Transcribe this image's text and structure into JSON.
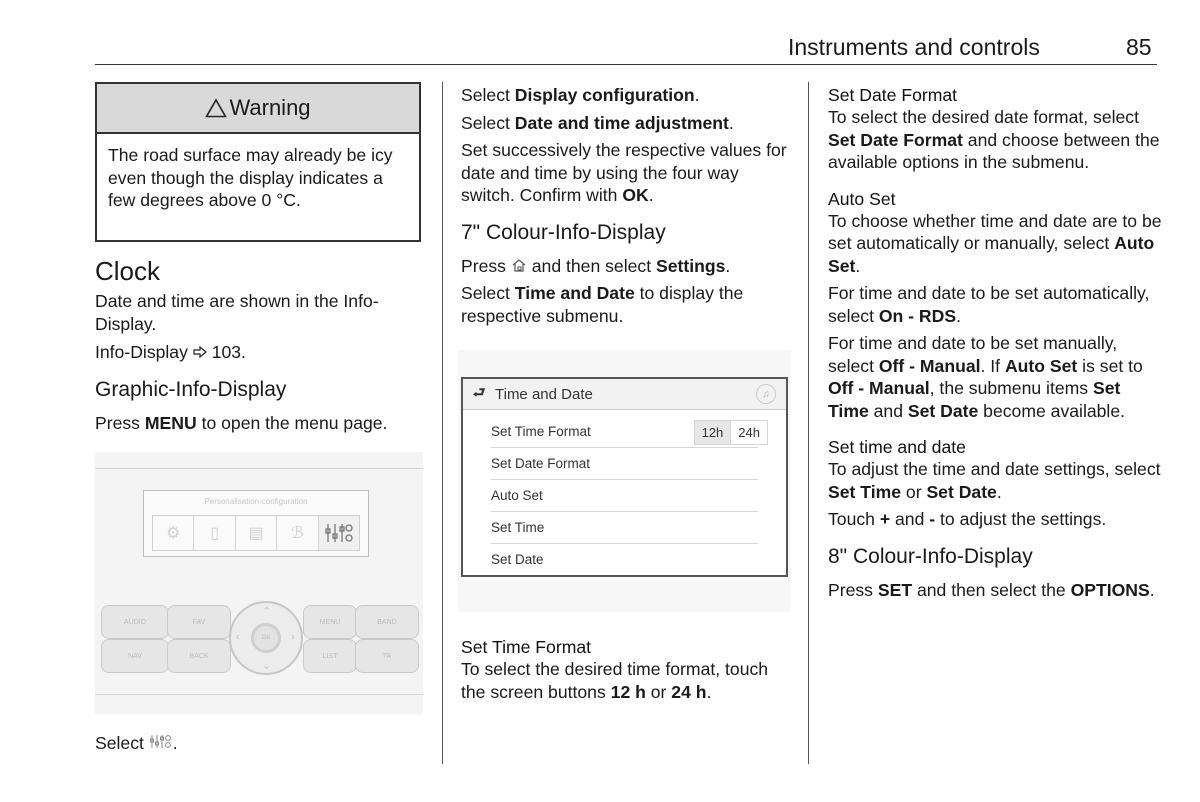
{
  "header": {
    "section_title": "Instruments and controls",
    "page_number": "85"
  },
  "warning": {
    "icon": "warning-triangle-icon",
    "title": "Warning",
    "text": "The road surface may already be icy even though the display indicates a few degrees above 0 °C."
  },
  "col1": {
    "clock_heading": "Clock",
    "clock_text": "Date and time are shown in the Info-Display.",
    "ref_text": "Info-Display",
    "ref_icon": "page-reference-arrow-icon",
    "ref_page": "103.",
    "graphic_heading": "Graphic-Info-Display",
    "press_pre": "Press ",
    "press_key": "MENU",
    "press_post": " to open the menu page.",
    "panel": {
      "screen_title": "Personalisation-configuration",
      "icons": [
        "vehicle-settings-icon",
        "phone-icon",
        "fuel-icon",
        "bluetooth-icon",
        "settings-sliders-icon"
      ],
      "buttons_top": [
        "AUDIO",
        "FAV",
        "MENU",
        "BAND"
      ],
      "buttons_bottom": [
        "NAV",
        "BACK",
        "LIST",
        "TA"
      ],
      "knob_label": "OK"
    },
    "select_pre": "Select ",
    "select_icon": "settings-sliders-icon",
    "select_post": "."
  },
  "col2": {
    "p1_pre": "Select ",
    "p1_bold": "Display configuration",
    "p1_post": ".",
    "p2_pre": "Select ",
    "p2_bold": "Date and time adjustment",
    "p2_post": ".",
    "p3_pre": "Set successively the respective values for date and time by using the four way switch. Confirm with ",
    "p3_bold": "OK",
    "p3_post": ".",
    "seven_heading": "7\" Colour-Info-Display",
    "p4_pre": "Press ",
    "p4_icon": "home-icon",
    "p4_mid": " and then select ",
    "p4_bold": "Settings",
    "p4_post": ".",
    "p5_pre": "Select ",
    "p5_bold": "Time and Date",
    "p5_post": " to display the respective submenu.",
    "screen": {
      "back_icon": "back-arrow-icon",
      "title": "Time and Date",
      "note_icon": "music-note-icon",
      "rows": [
        "Set Time Format",
        "Set Date Format",
        "Auto Set",
        "Set Time",
        "Set Date"
      ],
      "format_options": [
        "12h",
        "24h"
      ],
      "selected_format": "12h"
    },
    "stf_heading": "Set Time Format",
    "stf_pre": "To select the desired time format, touch the screen buttons ",
    "stf_b1": "12 h",
    "stf_mid": " or ",
    "stf_b2": "24 h",
    "stf_post": "."
  },
  "col3": {
    "sdf_heading": "Set Date Format",
    "sdf_pre": "To select the desired date format, select ",
    "sdf_bold": "Set Date Format",
    "sdf_post": " and choose between the available options in the submenu.",
    "as_heading": "Auto Set",
    "as_pre": "To choose whether time and date are to be set automatically or manually, select ",
    "as_bold": "Auto Set",
    "as_post": ".",
    "auto_pre": "For time and date to be set automatically, select ",
    "auto_bold": "On - RDS",
    "auto_post": ".",
    "man_pre": "For time and date to be set manually, select ",
    "man_b1": "Off - Manual",
    "man_m1": ". If ",
    "man_b2": "Auto Set",
    "man_m2": " is set to ",
    "man_b3": "Off - Manual",
    "man_m3": ", the submenu items ",
    "man_b4": "Set Time",
    "man_m4": " and ",
    "man_b5": "Set Date",
    "man_post": " become available.",
    "std_heading": "Set time and date",
    "std_pre": "To adjust the time and date settings, select ",
    "std_b1": "Set Time",
    "std_mid": " or ",
    "std_b2": "Set Date",
    "std_post": ".",
    "touch_pre": "Touch ",
    "touch_b1": "+",
    "touch_mid": " and ",
    "touch_b2": "-",
    "touch_post": " to adjust the settings.",
    "eight_heading": "8\" Colour-Info-Display",
    "set_pre": "Press ",
    "set_b1": "SET",
    "set_mid": " and then select the ",
    "set_b2": "OPTIONS",
    "set_post": "."
  }
}
